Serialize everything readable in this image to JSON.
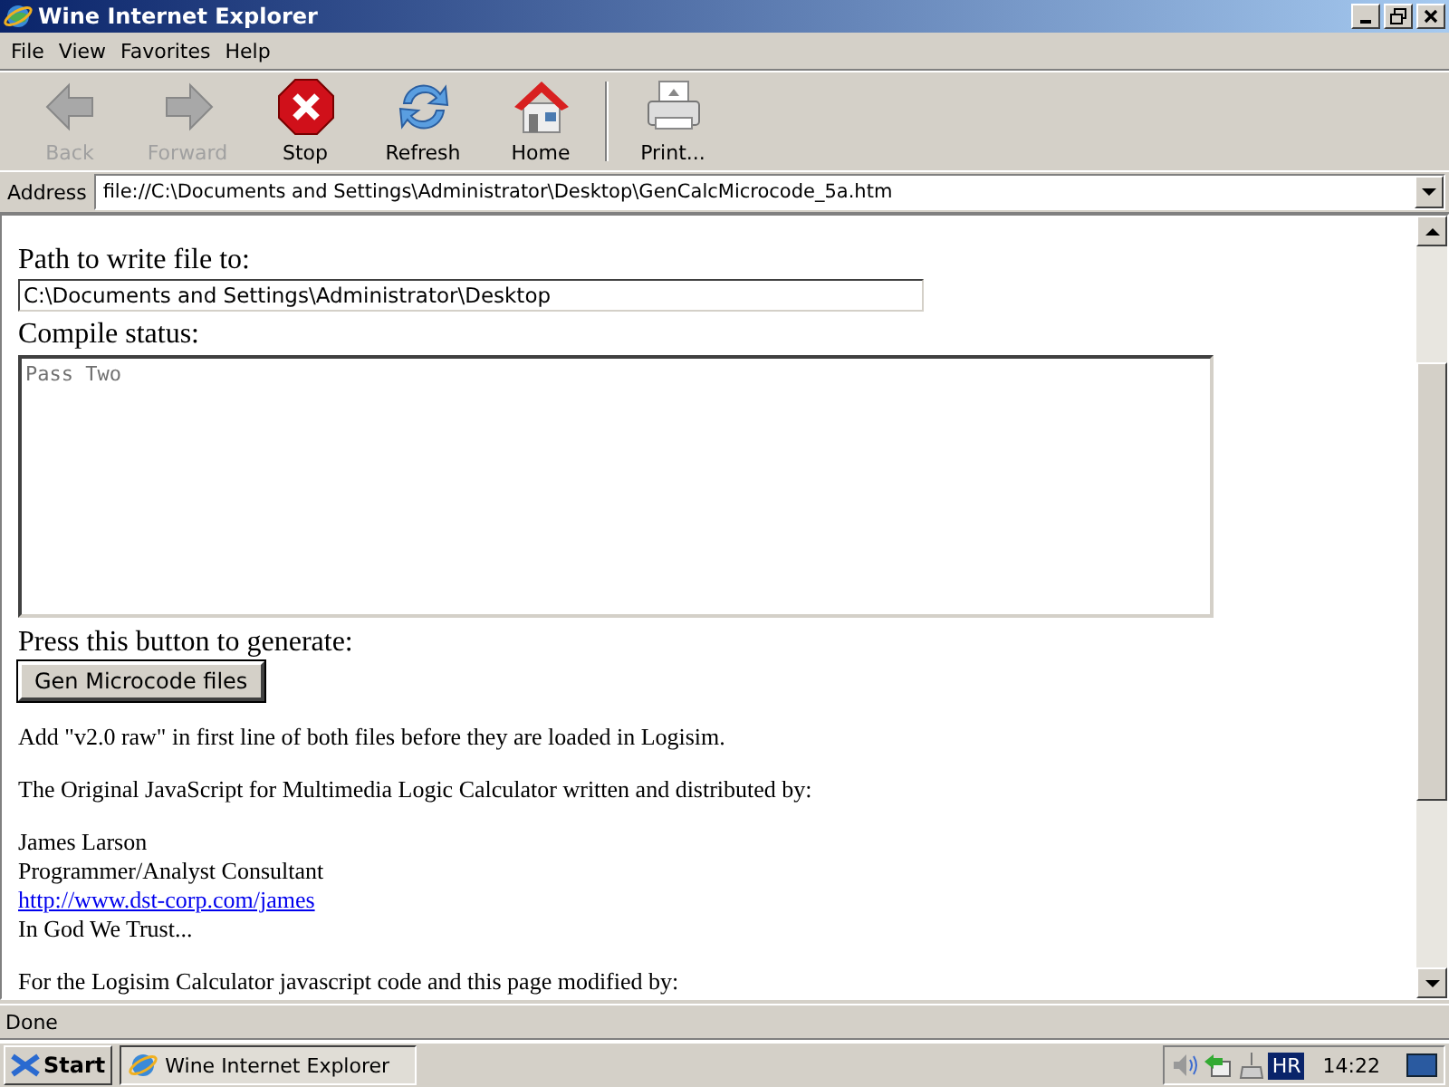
{
  "window": {
    "title": "Wine Internet Explorer"
  },
  "menu": [
    {
      "label": "File"
    },
    {
      "label": "View"
    },
    {
      "label": "Favorites"
    },
    {
      "label": "Help"
    }
  ],
  "toolbar": [
    {
      "kind": "back",
      "label": "Back",
      "disabled": true
    },
    {
      "kind": "forward",
      "label": "Forward",
      "disabled": true
    },
    {
      "kind": "stop",
      "label": "Stop",
      "disabled": false
    },
    {
      "kind": "refresh",
      "label": "Refresh",
      "disabled": false
    },
    {
      "kind": "home",
      "label": "Home",
      "disabled": false
    },
    {
      "kind": "print",
      "label": "Print...",
      "disabled": false
    }
  ],
  "address": {
    "label": "Address",
    "value": "file://C:\\Documents and Settings\\Administrator\\Desktop\\GenCalcMicrocode_5a.htm"
  },
  "page": {
    "path_label": "Path to write file to:",
    "path_value": "C:\\Documents and Settings\\Administrator\\Desktop",
    "status_label": "Compile status:",
    "status_value": "Pass Two",
    "button_label": "Press this button to generate:",
    "button": "Gen Microcode files",
    "blocks": [
      {
        "lines": [
          {
            "kind": "text",
            "text": "Add \"v2.0 raw\" in first line of both files before they are loaded in Logisim."
          }
        ]
      },
      {
        "lines": [
          {
            "kind": "text",
            "text": "The Original JavaScript for Multimedia Logic Calculator written and distributed by:"
          }
        ]
      },
      {
        "lines": [
          {
            "kind": "text",
            "text": "James Larson"
          },
          {
            "kind": "text",
            "text": "Programmer/Analyst Consultant"
          },
          {
            "kind": "link",
            "text": "http://www.dst-corp.com/james"
          },
          {
            "kind": "text",
            "text": "In God We Trust..."
          }
        ]
      },
      {
        "lines": [
          {
            "kind": "text",
            "text": "For the Logisim Calculator javascript code and this page modified by:"
          }
        ]
      }
    ]
  },
  "status_bar": "Done",
  "taskbar": {
    "start": "Start",
    "task": "Wine Internet Explorer",
    "language": "HR",
    "clock": "14:22"
  }
}
